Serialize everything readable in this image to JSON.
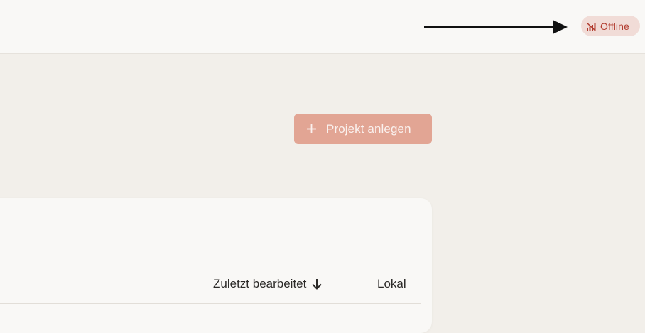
{
  "topbar": {
    "status_badge": {
      "label": "Offline",
      "icon": "signal-off-icon",
      "color": "#b23c2f",
      "background": "#f1dcd7"
    },
    "pointer": "arrow-right-icon"
  },
  "main": {
    "create_button": {
      "label": "Projekt anlegen",
      "icon": "plus-icon",
      "background": "#e2a594"
    },
    "table": {
      "columns": [
        {
          "label": "Zuletzt bearbeitet",
          "sort": "descending",
          "sort_icon": "arrow-down-icon"
        },
        {
          "label": "Lokal"
        }
      ]
    }
  },
  "colors": {
    "background": "#f2efea",
    "surface": "#f9f8f6",
    "text": "#2c2a28"
  }
}
